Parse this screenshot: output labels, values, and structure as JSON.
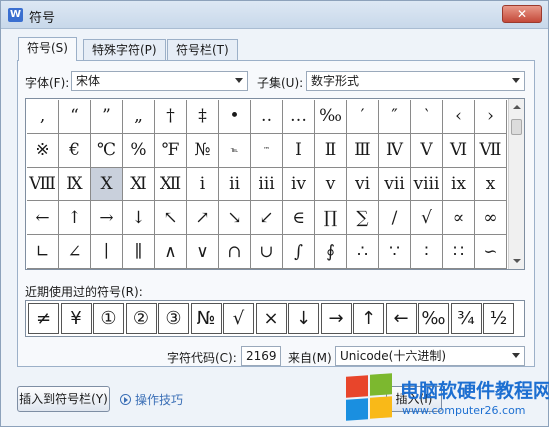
{
  "window": {
    "title": "符号",
    "close_glyph": "✕"
  },
  "tabs": [
    {
      "label": "符号(S)",
      "active": true
    },
    {
      "label": "特殊字符(P)",
      "active": false
    },
    {
      "label": "符号栏(T)",
      "active": false
    }
  ],
  "font": {
    "label": "字体(F):",
    "value": "宋体"
  },
  "subset": {
    "label": "子集(U):",
    "value": "数字形式"
  },
  "symbols": [
    [
      "‚",
      "“",
      "”",
      "„",
      "†",
      "‡",
      "•",
      "‥",
      "…",
      "‰",
      "′",
      "″",
      "‵",
      "‹",
      "›"
    ],
    [
      "※",
      "€",
      "℃",
      "%",
      "℉",
      "№",
      "℡",
      "™",
      "Ⅰ",
      "Ⅱ",
      "Ⅲ",
      "Ⅳ",
      "Ⅴ",
      "Ⅵ",
      "Ⅶ"
    ],
    [
      "Ⅷ",
      "Ⅸ",
      "Ⅹ",
      "Ⅺ",
      "Ⅻ",
      "ⅰ",
      "ⅱ",
      "ⅲ",
      "ⅳ",
      "ⅴ",
      "ⅵ",
      "ⅶ",
      "ⅷ",
      "ⅸ",
      "ⅹ"
    ],
    [
      "←",
      "↑",
      "→",
      "↓",
      "↖",
      "↗",
      "↘",
      "↙",
      "∈",
      "∏",
      "∑",
      "∕",
      "√",
      "∝",
      "∞"
    ],
    [
      "∟",
      "∠",
      "∣",
      "∥",
      "∧",
      "∨",
      "∩",
      "∪",
      "∫",
      "∮",
      "∴",
      "∵",
      "∶",
      "∷",
      "∽"
    ]
  ],
  "selected_symbol": {
    "row": 2,
    "col": 2
  },
  "recent": {
    "label": "近期使用过的符号(R):",
    "items": [
      "≠",
      "¥",
      "①",
      "②",
      "③",
      "№",
      "√",
      "×",
      "↓",
      "→",
      "↑",
      "←",
      "‰",
      "¾",
      "½"
    ]
  },
  "char_code": {
    "label": "字符代码(C):",
    "value": "2169"
  },
  "from": {
    "label": "来自(M)",
    "value": "Unicode(十六进制)"
  },
  "buttons": {
    "insert_to_bar": "插入到符号栏(Y)",
    "tips": "操作技巧",
    "insert": "插入(I)"
  },
  "watermark": {
    "text": "电脑软硬件教程网",
    "url": "www.computer26.com"
  },
  "colors": {
    "accent": "#3b6fb6",
    "selection": "#c9d0dc",
    "watermark": "#1d6fd1"
  }
}
